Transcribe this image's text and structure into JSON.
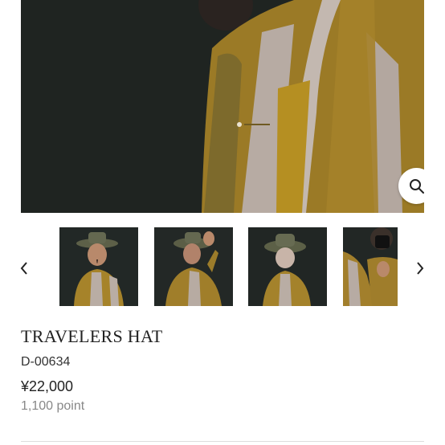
{
  "hero_image": {
    "description_icon": "model-wearing-striped-shirt-photo"
  },
  "gallery": {
    "thumbnails": [
      {
        "icon": "model-wearing-hat-front-photo"
      },
      {
        "icon": "model-touching-hat-photo"
      },
      {
        "icon": "model-hat-side-photo"
      },
      {
        "icon": "model-holding-camera-photo"
      }
    ],
    "prev_icon": "chevron-left-icon",
    "next_icon": "chevron-right-icon",
    "zoom_icon": "search-icon"
  },
  "product": {
    "name": "TRAVELERS HAT",
    "code": "D-00634",
    "price": "¥22,000",
    "points": "1,100 point"
  },
  "colors": {
    "mustard": "#a8862a",
    "grey_stripe": "#b6aaa1",
    "background_dark": "#1f2421"
  }
}
